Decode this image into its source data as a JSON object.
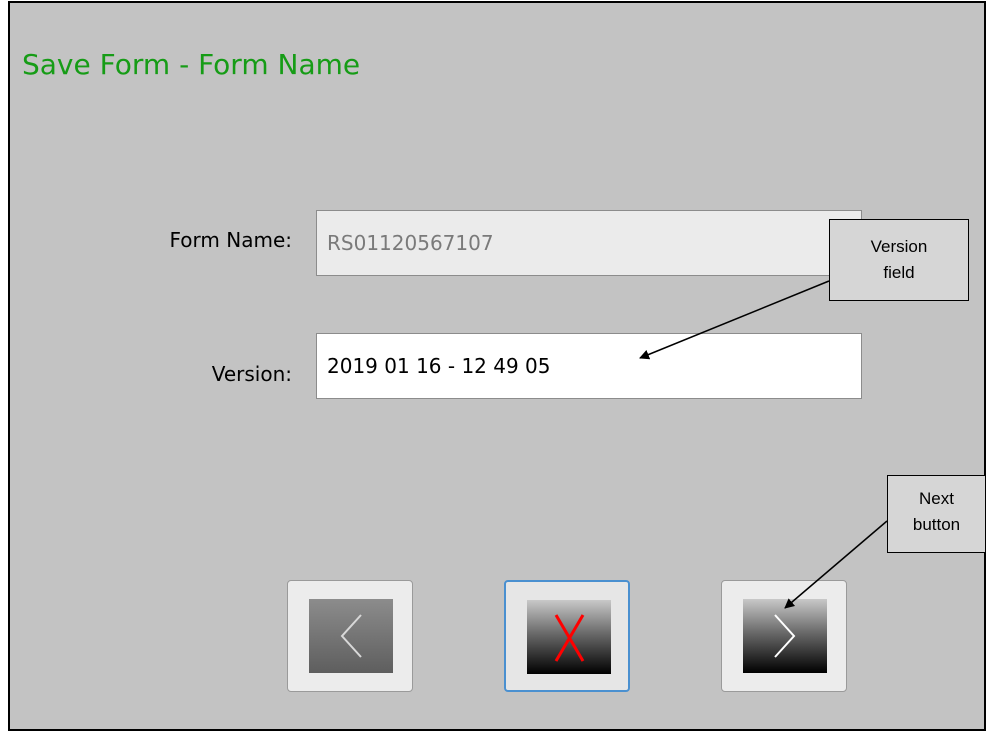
{
  "dialog": {
    "title": "Save Form - Form Name"
  },
  "fields": {
    "form_name_label": "Form Name:",
    "form_name_value": "RS01120567107",
    "version_label": "Version:",
    "version_value": "2019 01 16 - 12 49 05"
  },
  "buttons": {
    "prev_icon": "chevron-left-icon",
    "cancel_icon": "x-icon",
    "next_icon": "chevron-right-icon"
  },
  "callouts": {
    "version": {
      "line1": "Version",
      "line2": "field"
    },
    "next": {
      "line1": "Next",
      "line2": "button"
    }
  },
  "colors": {
    "title": "#169c16",
    "cancel_x": "#ff0000",
    "focus_border": "#4a90d0",
    "dialog_bg": "#c3c3c3"
  }
}
